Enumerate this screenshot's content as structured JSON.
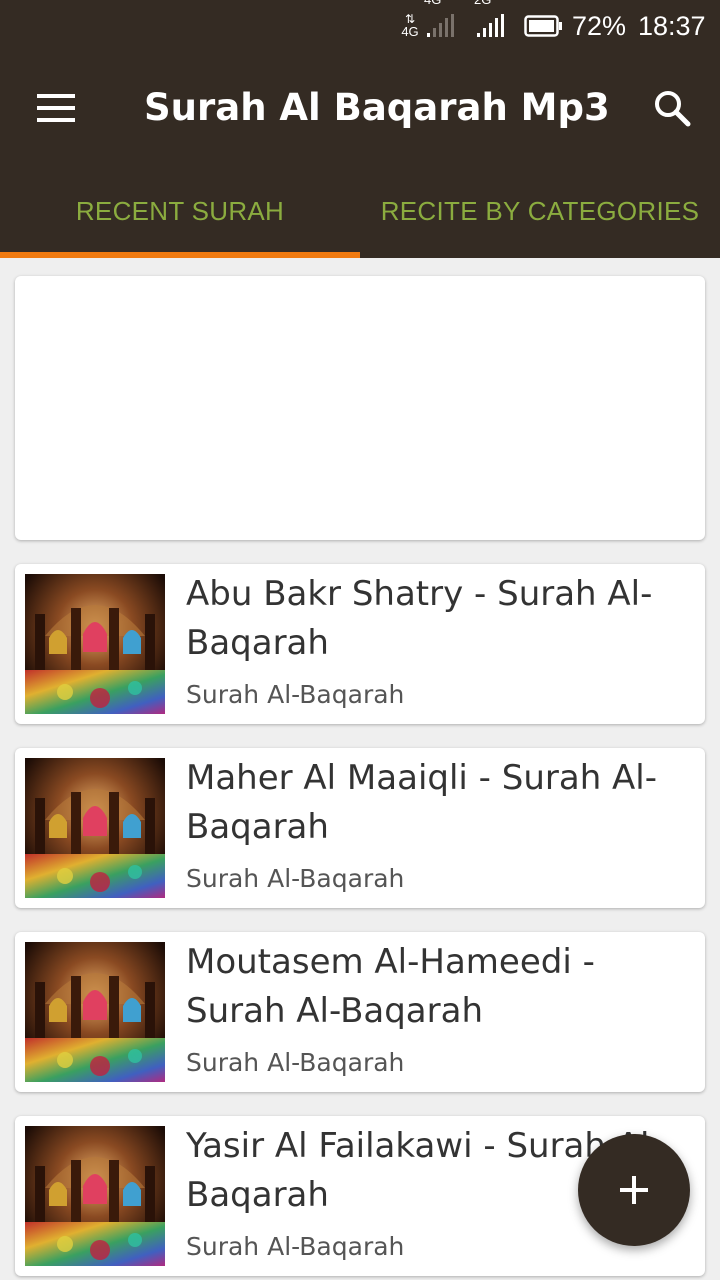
{
  "status_bar": {
    "sim1_label_top": "4G",
    "sim1_label_bottom": "4G",
    "sim2_label": "2G",
    "battery_percent": "72%",
    "time": "18:37"
  },
  "app_bar": {
    "title": "Surah Al Baqarah Mp3",
    "menu_icon": "hamburger-menu-icon",
    "search_icon": "search-icon"
  },
  "tabs": [
    {
      "label": "RECENT SURAH",
      "active": true
    },
    {
      "label": "RECITE BY CATEGORIES",
      "active": false
    }
  ],
  "list": {
    "items": [
      {
        "title": "Abu Bakr Shatry - Surah Al-Baqarah",
        "subtitle": "Surah Al-Baqarah"
      },
      {
        "title": "Maher Al Maaiqli - Surah Al-Baqarah",
        "subtitle": "Surah Al-Baqarah"
      },
      {
        "title": "Moutasem Al-Hameedi - Surah Al-Baqarah",
        "subtitle": "Surah Al-Baqarah"
      },
      {
        "title": "Yasir Al Failakawi - Surah Al-Baqarah",
        "subtitle": "Surah Al-Baqarah"
      }
    ]
  },
  "fab": {
    "icon": "plus-icon"
  },
  "colors": {
    "primary_dark": "#342b23",
    "tab_text": "#8bac3f",
    "tab_indicator": "#f07a10",
    "background": "#efefef"
  }
}
